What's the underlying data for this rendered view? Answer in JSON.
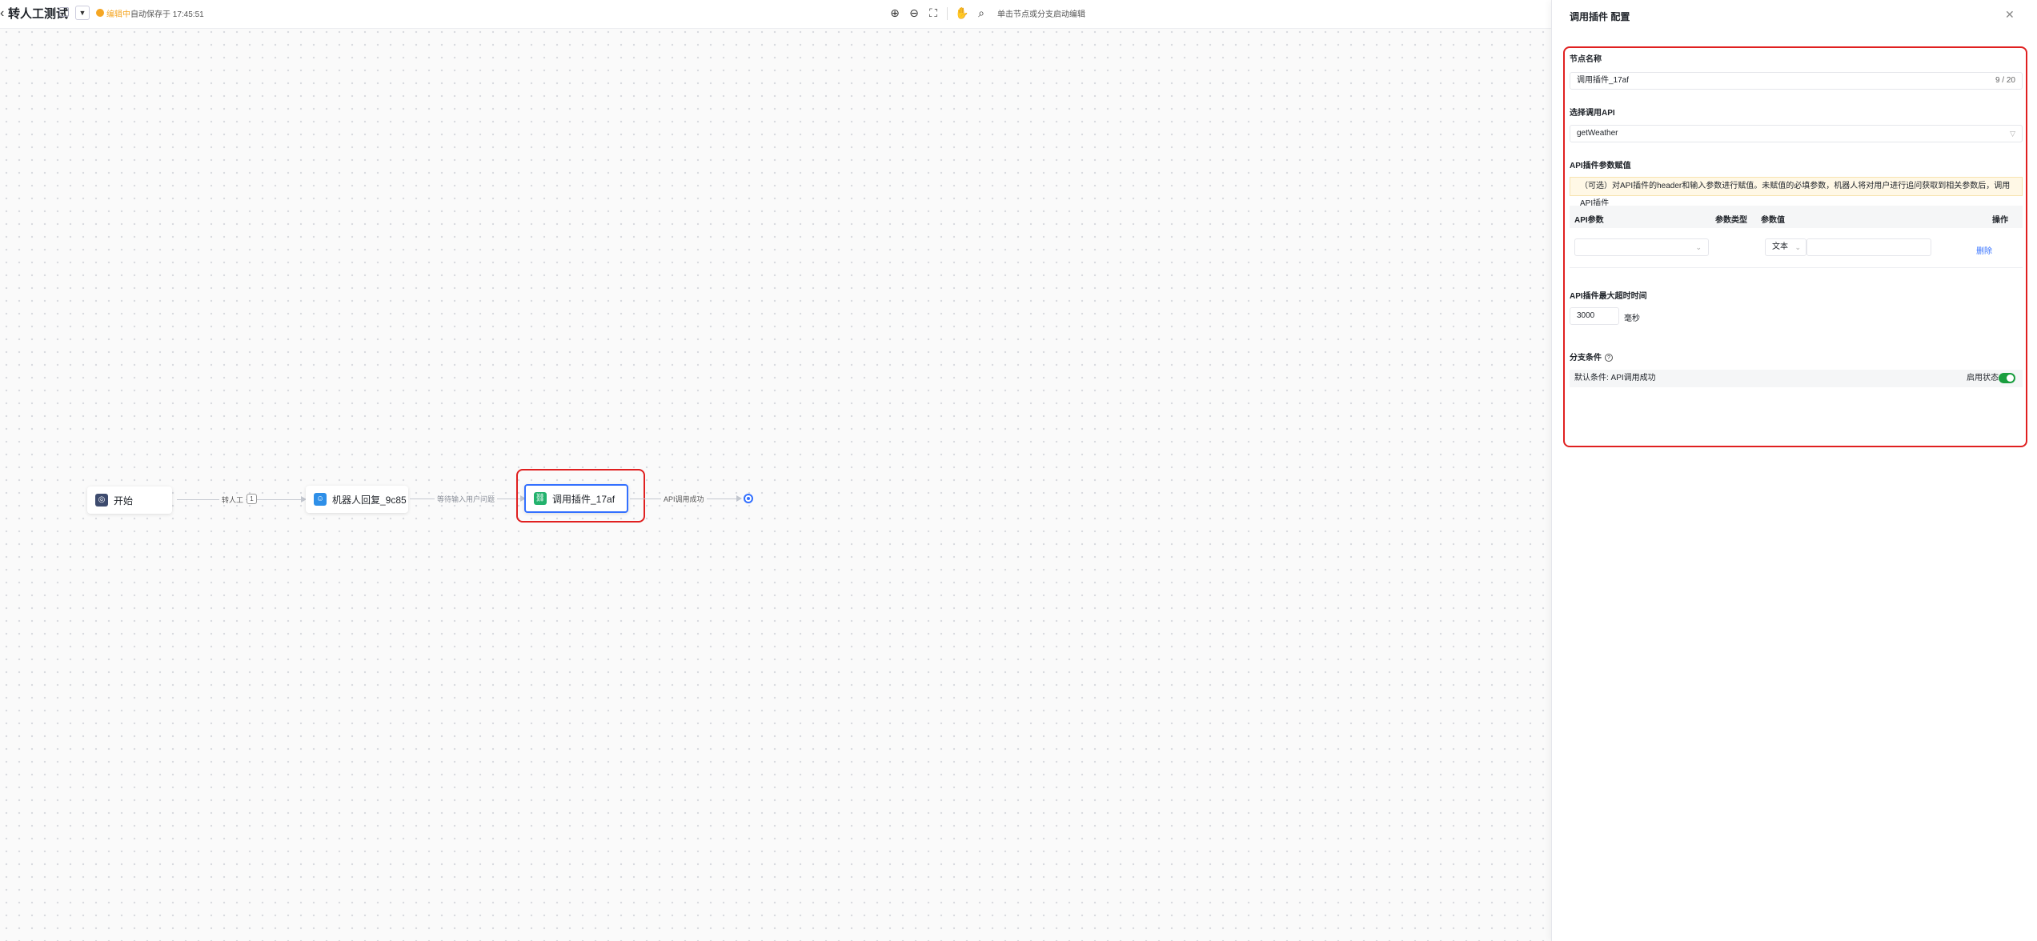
{
  "header": {
    "back_icon": "chevron-left-icon",
    "title": "转人工测试",
    "status": "编辑中",
    "autosave": "自动保存于 17:45:51",
    "hint": "单击节点或分支启动编辑",
    "tools": [
      "zoom-in-icon",
      "zoom-out-icon",
      "fit-screen-icon",
      "hand-icon",
      "search-node-icon"
    ]
  },
  "flow": {
    "nodes": {
      "start": "开始",
      "bot_reply": "机器人回复_9c85",
      "plugin": "调用插件_17af"
    },
    "edges": {
      "e1_label": "转人工",
      "e1_badge": "1",
      "e2_label": "等待输入用户问题",
      "e3_label": "API调用成功"
    },
    "highlight_color": "#e02020",
    "accent": "#3370ff"
  },
  "panel": {
    "title": "调用插件 配置",
    "node_name_label": "节点名称",
    "node_name_value": "调用插件_17af",
    "node_name_count": "9 / 20",
    "api_label": "选择调用API",
    "api_value": "getWeather",
    "params_label": "API插件参数赋值",
    "params_notice": "（可选）对API插件的header和输入参数进行赋值。未赋值的必填参数，机器人将对用户进行追问获取到相关参数后，调用API插件",
    "table_headers": {
      "param": "API参数",
      "type": "参数类型",
      "value": "参数值",
      "action": "操作"
    },
    "row": {
      "value_type": "文本",
      "delete": "删除"
    },
    "timeout_label": "API插件最大超时时间",
    "timeout_value": "3000",
    "timeout_unit": "毫秒",
    "branch_label": "分支条件",
    "default_condition": "默认条件: API调用成功",
    "enable_label": "启用状态:"
  }
}
